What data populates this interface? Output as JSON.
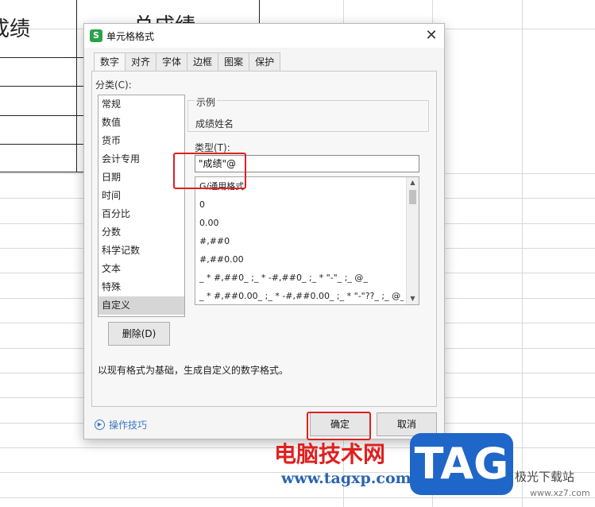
{
  "sheet": {
    "cell_left": "成绩",
    "cell_right": "总成绩"
  },
  "dialog": {
    "app_icon": "S",
    "title": "单元格格式",
    "close_label": "✕",
    "tabs": [
      {
        "label": "数字",
        "active": true
      },
      {
        "label": "对齐"
      },
      {
        "label": "字体"
      },
      {
        "label": "边框"
      },
      {
        "label": "图案"
      },
      {
        "label": "保护"
      }
    ],
    "category_label": "分类(C):",
    "categories": [
      "常规",
      "数值",
      "货币",
      "会计专用",
      "日期",
      "时间",
      "百分比",
      "分数",
      "科学记数",
      "文本",
      "特殊",
      "自定义"
    ],
    "selected_category": "自定义",
    "delete_button": "删除(D)",
    "sample_label": "示例",
    "sample_value": "成绩姓名",
    "type_label": "类型(T):",
    "type_value": "\"成绩\"@",
    "formats": [
      "G/通用格式",
      "0",
      "0.00",
      "#,##0",
      "#,##0.00",
      "_ * #,##0_ ;_ * -#,##0_ ;_ * \"-\"_ ;_ @_",
      "_ * #,##0.00_ ;_ * -#,##0.00_ ;_ * \"-\"??_ ;_ @_"
    ],
    "description": "以现有格式为基础，生成自定义的数字格式。",
    "tips_label": "操作技巧",
    "ok_button": "确定",
    "cancel_button": "取消"
  },
  "watermark": {
    "cn_text": "电脑技术网",
    "url": "www.tagxp.com",
    "logo": "TAG",
    "site_text": "极光下载站",
    "site_url": "www.xz7.com"
  },
  "colors": {
    "annotation": "#e02020",
    "link": "#3a78c9",
    "app_icon": "#2aa24a",
    "logo_bg": "#1f66c9"
  }
}
